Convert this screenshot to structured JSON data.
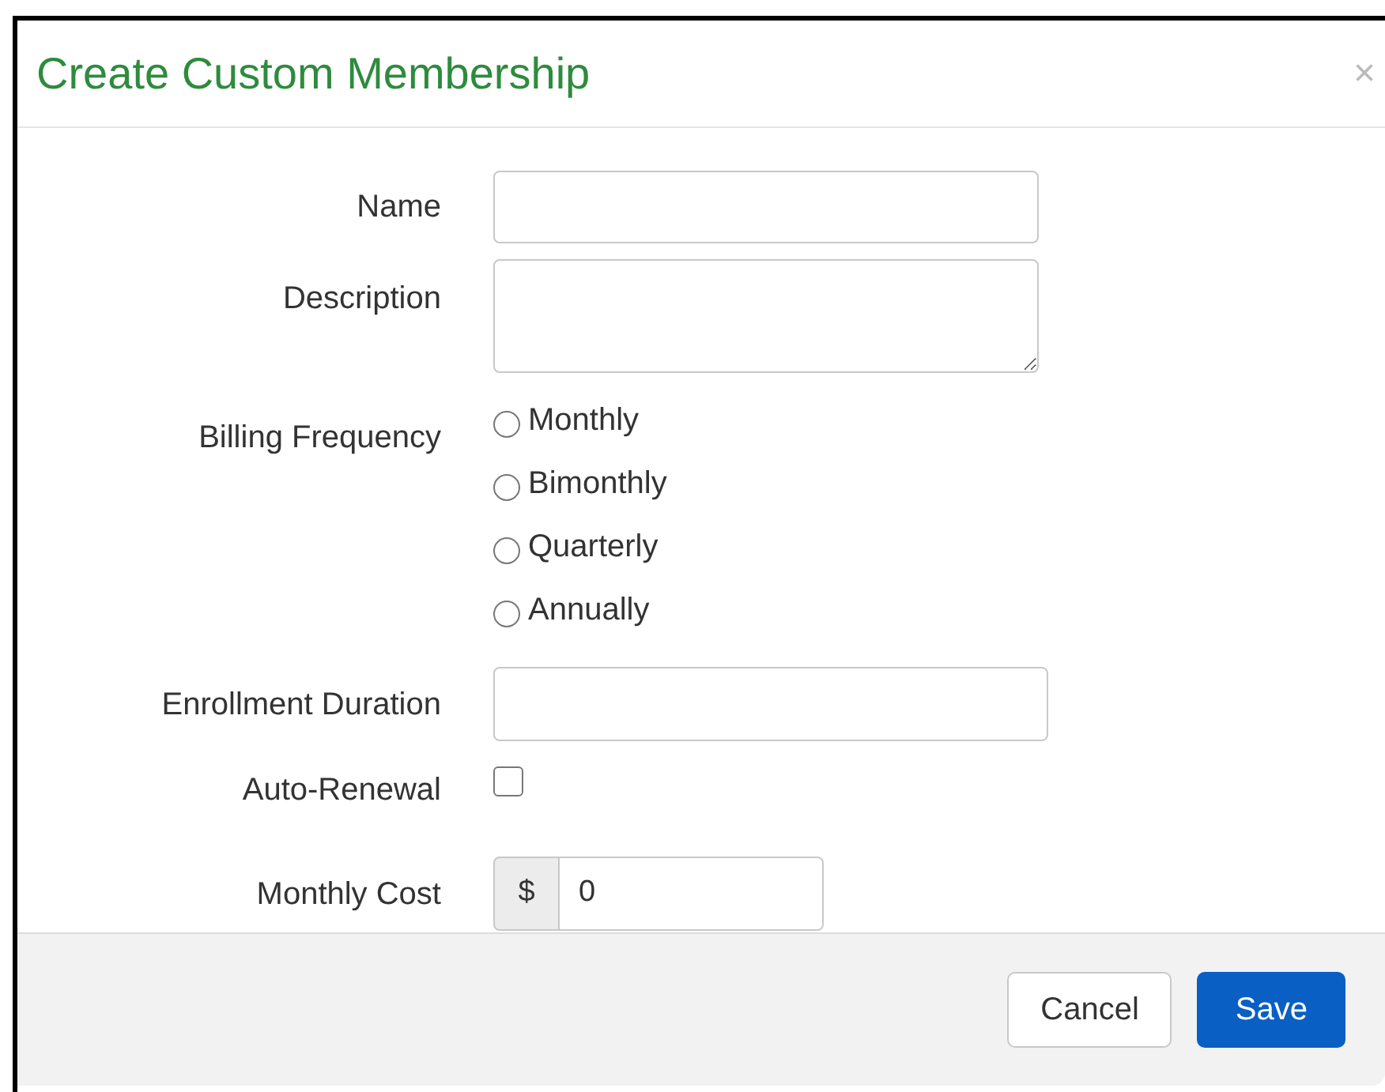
{
  "dialog": {
    "title": "Create Custom Membership",
    "close": "×"
  },
  "fields": [
    {
      "kind": "text",
      "label": "Name"
    },
    {
      "kind": "textarea",
      "label": "Description"
    },
    {
      "kind": "radio",
      "label": "Billing Frequency",
      "options": [
        {
          "label": "Monthly",
          "selected": false
        },
        {
          "label": "Bimonthly",
          "selected": false
        },
        {
          "label": "Quarterly",
          "selected": false
        },
        {
          "label": "Annually",
          "selected": false
        }
      ]
    },
    {
      "kind": "wide",
      "label": "Enrollment Duration"
    },
    {
      "kind": "checkbox",
      "label": "Auto-Renewal",
      "checked": false
    },
    {
      "kind": "money",
      "label": "Monthly Cost",
      "prefix": "$",
      "value": "0"
    }
  ],
  "buttons": [
    {
      "label": "Cancel",
      "kind": "secondary"
    },
    {
      "label": "Save",
      "kind": "primary"
    }
  ]
}
